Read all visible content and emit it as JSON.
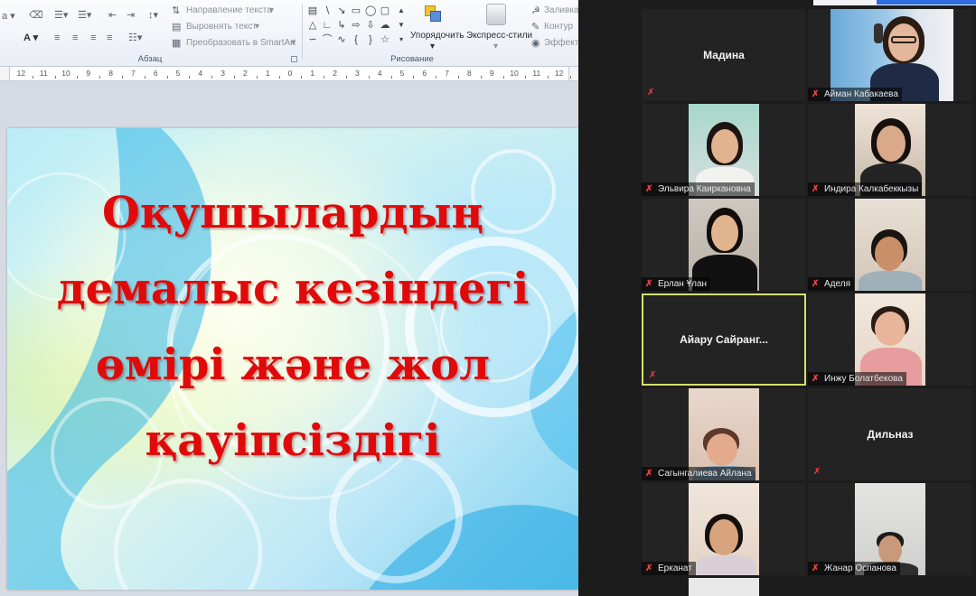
{
  "ribbon": {
    "text_direction": "Направление текста",
    "align_text": "Выровнять текст",
    "convert_smartart": "Преобразовать в SmartArt",
    "paragraph_group": "Абзац",
    "arrange": "Упорядочить",
    "quick_styles": "Экспресс-стили",
    "drawing_group": "Рисование",
    "shape_fill": "Заливка",
    "shape_outline": "Контур",
    "shape_effects": "Эффект"
  },
  "ruler": {
    "ticks": [
      "12",
      "11",
      "10",
      "9",
      "8",
      "7",
      "6",
      "5",
      "4",
      "3",
      "2",
      "1",
      "0",
      "1",
      "2",
      "3",
      "4",
      "5",
      "6",
      "7",
      "8",
      "9",
      "10",
      "11",
      "12"
    ]
  },
  "slide": {
    "title_lines": [
      "Оқушылардың",
      "демалыс кезіндегі",
      "өмірі және жол",
      "қауіпсіздігі"
    ],
    "title_color": "#e00a0a"
  },
  "zoom": {
    "accent_active": "#d7e06a",
    "muted_icon_color": "#ef4444",
    "participants": [
      {
        "name": "Мадина",
        "video": false
      },
      {
        "name": "Айман Кабакаева",
        "video": true
      },
      {
        "name": "Эльвира Каиркановна",
        "video": true
      },
      {
        "name": "Индира Калкабеккызы",
        "video": true
      },
      {
        "name": "Ерлан Ұлан",
        "video": true
      },
      {
        "name": "Аделя",
        "video": true
      },
      {
        "name": "Айару  Сайранг...",
        "video": false,
        "active": true
      },
      {
        "name": "Инжу Болатбекова",
        "video": true
      },
      {
        "name": "Сагынгалиева Айлана",
        "video": true
      },
      {
        "name": "Дильназ",
        "video": false
      },
      {
        "name": "Ерканат",
        "video": true
      },
      {
        "name": "Жанар Оспанова",
        "video": true
      }
    ]
  }
}
